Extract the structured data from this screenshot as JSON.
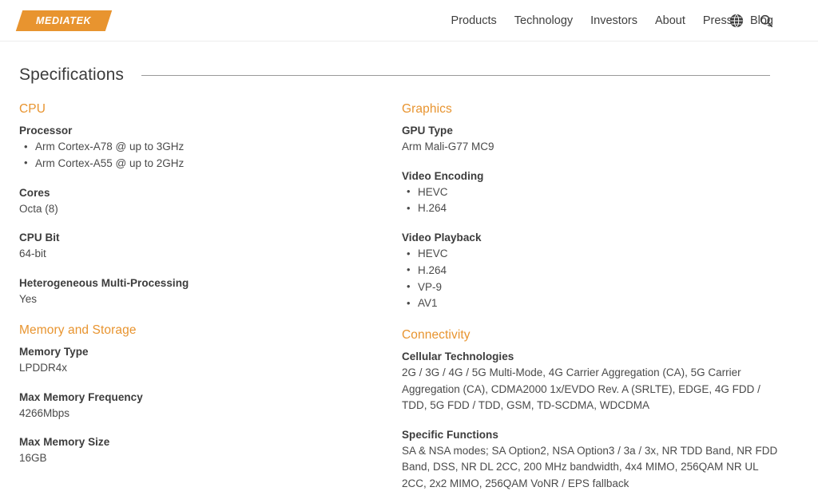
{
  "header": {
    "logo_text": "MEDIATEK",
    "nav_items": [
      {
        "label": "Products"
      },
      {
        "label": "Technology"
      },
      {
        "label": "Investors"
      },
      {
        "label": "About"
      },
      {
        "label": "Press"
      },
      {
        "label": "Blog"
      }
    ],
    "icons": [
      {
        "name": "globe-icon"
      },
      {
        "name": "search-icon"
      }
    ]
  },
  "page": {
    "title": "Specifications"
  },
  "left_column": [
    {
      "heading": "CPU",
      "blocks": [
        {
          "label": "Processor",
          "type": "list",
          "items": [
            "Arm Cortex-A78 @ up to 3GHz",
            "Arm Cortex-A55 @ up to 2GHz"
          ]
        },
        {
          "label": "Cores",
          "type": "text",
          "value": "Octa (8)"
        },
        {
          "label": "CPU Bit",
          "type": "text",
          "value": "64-bit"
        },
        {
          "label": "Heterogeneous Multi-Processing",
          "type": "text",
          "value": "Yes"
        }
      ]
    },
    {
      "heading": "Memory and Storage",
      "blocks": [
        {
          "label": "Memory Type",
          "type": "text",
          "value": "LPDDR4x"
        },
        {
          "label": "Max Memory Frequency",
          "type": "text",
          "value": "4266Mbps"
        },
        {
          "label": "Max Memory Size",
          "type": "text",
          "value": "16GB"
        }
      ]
    }
  ],
  "right_column": [
    {
      "heading": "Graphics",
      "blocks": [
        {
          "label": "GPU Type",
          "type": "text",
          "value": "Arm Mali-G77 MC9"
        },
        {
          "label": "Video Encoding",
          "type": "list",
          "items": [
            "HEVC",
            "H.264"
          ]
        },
        {
          "label": "Video Playback",
          "type": "list",
          "items": [
            "HEVC",
            "H.264",
            "VP-9",
            "AV1"
          ]
        }
      ]
    },
    {
      "heading": "Connectivity",
      "blocks": [
        {
          "label": "Cellular Technologies",
          "type": "text",
          "value": "2G / 3G / 4G / 5G Multi-Mode, 4G Carrier Aggregation (CA), 5G Carrier Aggregation (CA), CDMA2000 1x/EVDO Rev. A (SRLTE), EDGE, 4G FDD / TDD, 5G FDD / TDD, GSM, TD-SCDMA, WDCDMA"
        },
        {
          "label": "Specific Functions",
          "type": "text",
          "value": "SA & NSA modes; SA Option2, NSA Option3 / 3a / 3x, NR TDD Band, NR FDD Band, DSS, NR DL 2CC, 200 MHz bandwidth, 4x4 MIMO, 256QAM NR UL 2CC, 2x2 MIMO, 256QAM VoNR / EPS fallback"
        }
      ]
    }
  ],
  "colors": {
    "brand_orange": "#E8942F",
    "text_dark": "#3c3c3c",
    "text_body": "#4a4a4a"
  }
}
